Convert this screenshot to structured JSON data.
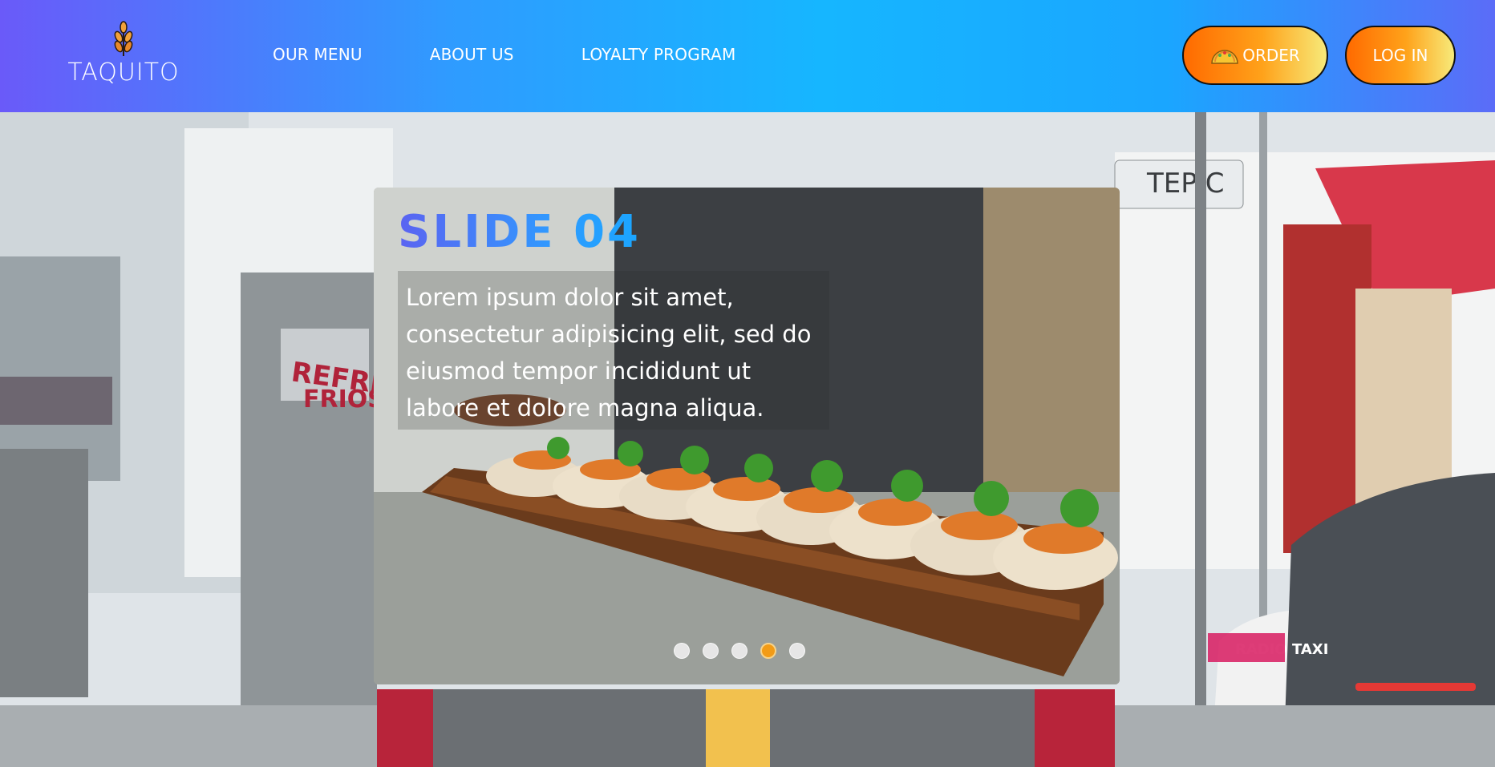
{
  "header": {
    "logo_text": "TAQUITO",
    "nav": [
      {
        "label": "OUR MENU"
      },
      {
        "label": "ABOUT US"
      },
      {
        "label": "LOYALTY PROGRAM"
      }
    ],
    "order_button": {
      "label": "ORDER",
      "icon": "taco-icon"
    },
    "login_button": {
      "label": "LOG IN"
    }
  },
  "slider": {
    "title": "SLIDE 04",
    "text": "Lorem ipsum dolor sit amet, consectetur adipisicing elit, sed do eiusmod tempor incididunt ut labore et dolore magna aliqua.",
    "slide_count": 5,
    "active_index": 3
  },
  "colors": {
    "header_gradient": [
      "#6a5af9",
      "#16b6ff",
      "#5b6cf8"
    ],
    "button_gradient": [
      "#ff6a00",
      "#f7ea7a"
    ],
    "title_gradient": [
      "#5b63f1",
      "#1aa6ff"
    ],
    "active_dot": "#f29b16"
  },
  "background_signs": {
    "tepic": "TEPIC",
    "refresco": "REFRESCO",
    "frios": "FRIOS",
    "radio_taxi": "RADIO TAXI"
  }
}
